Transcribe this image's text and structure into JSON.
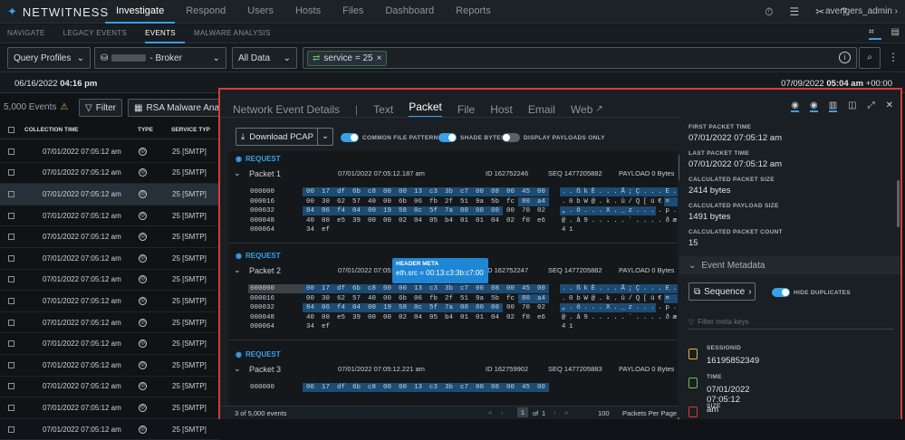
{
  "brand": {
    "name": "NETWITNESS"
  },
  "nav": {
    "items": [
      "Investigate",
      "Respond",
      "Users",
      "Hosts",
      "Files",
      "Dashboard",
      "Reports"
    ],
    "user": "avengers_admin"
  },
  "subnav": {
    "items": [
      "NAVIGATE",
      "LEGACY EVENTS",
      "EVENTS",
      "MALWARE ANALYSIS"
    ]
  },
  "query": {
    "profile": "Query Profiles",
    "service": "- Broker",
    "timerange": "All Data",
    "filter": "service = 25"
  },
  "time": {
    "start_date": "06/16/2022",
    "start_time": "04:16 pm",
    "end_date": "07/09/2022",
    "end_time": "05:04 am",
    "end_tz": "+00:00"
  },
  "events": {
    "count": "5,000 Events",
    "filter_label": "Filter",
    "profile": "RSA Malware Analysis",
    "columns": [
      "COLLECTION TIME",
      "TYPE",
      "SERVICE TYP"
    ],
    "rows": [
      {
        "time": "07/01/2022 07:05:12 am",
        "service": "25 [SMTP]"
      },
      {
        "time": "07/01/2022 07:05:12 am",
        "service": "25 [SMTP]"
      },
      {
        "time": "07/01/2022 07:05:12 am",
        "service": "25 [SMTP]"
      },
      {
        "time": "07/01/2022 07:05:12 am",
        "service": "25 [SMTP]"
      },
      {
        "time": "07/01/2022 07:05:12 am",
        "service": "25 [SMTP]"
      },
      {
        "time": "07/01/2022 07:05:12 am",
        "service": "25 [SMTP]"
      },
      {
        "time": "07/01/2022 07:05:12 am",
        "service": "25 [SMTP]"
      },
      {
        "time": "07/01/2022 07:05:12 am",
        "service": "25 [SMTP]"
      },
      {
        "time": "07/01/2022 07:05:12 am",
        "service": "25 [SMTP]"
      },
      {
        "time": "07/01/2022 07:05:12 am",
        "service": "25 [SMTP]"
      },
      {
        "time": "07/01/2022 07:05:12 am",
        "service": "25 [SMTP]"
      },
      {
        "time": "07/01/2022 07:05:12 am",
        "service": "25 [SMTP]"
      },
      {
        "time": "07/01/2022 07:05:12 am",
        "service": "25 [SMTP]"
      },
      {
        "time": "07/01/2022 07:05:12 am",
        "service": "25 [SMTP]"
      }
    ]
  },
  "panel": {
    "tabs": [
      "Network Event Details",
      "Text",
      "Packet",
      "File",
      "Host",
      "Email",
      "Web"
    ],
    "download": "Download PCAP",
    "opt1": "COMMON FILE PATTERNS",
    "opt2": "SHADE BYTES",
    "opt3": "DISPLAY PAYLOADS ONLY",
    "request": "REQUEST",
    "packets": [
      {
        "name": "Packet 1",
        "time": "07/01/2022 07:05:12.187 am",
        "id": "ID 162752246",
        "seq": "SEQ 1477205882",
        "payload": "PAYLOAD 0 Bytes"
      },
      {
        "name": "Packet 2",
        "time": "07/01/2022 07:05:12.2",
        "id": "ID 162752247",
        "seq": "SEQ 1477205882",
        "payload": "PAYLOAD 0 Bytes"
      },
      {
        "name": "Packet 3",
        "time": "07/01/2022 07:05:12.221 am",
        "id": "ID 162759902",
        "seq": "SEQ 1477205883",
        "payload": "PAYLOAD 0 Bytes"
      }
    ],
    "offsets": [
      "000000",
      "000016",
      "000032",
      "000048",
      "000064"
    ],
    "hex": [
      [
        "00",
        "17",
        "df",
        "6b",
        "c8",
        "00",
        "00",
        "13",
        "c3",
        "3b",
        "c7",
        "00",
        "08",
        "00",
        "45",
        "00"
      ],
      [
        "00",
        "30",
        "62",
        "57",
        "40",
        "00",
        "6b",
        "06",
        "fb",
        "2f",
        "51",
        "9a",
        "5b",
        "fc",
        "80",
        "a4"
      ],
      [
        "84",
        "06",
        "f4",
        "04",
        "00",
        "19",
        "58",
        "0c",
        "5f",
        "7a",
        "00",
        "00",
        "00",
        "00",
        "70",
        "02"
      ],
      [
        "40",
        "00",
        "e5",
        "39",
        "00",
        "00",
        "02",
        "04",
        "05",
        "b4",
        "01",
        "01",
        "04",
        "02",
        "f0",
        "e6"
      ],
      [
        "34",
        "ef"
      ]
    ],
    "ascii": [
      [
        ".",
        ".",
        "ß",
        "k",
        "È",
        ".",
        ".",
        ".",
        "Ã",
        ";",
        "Ç",
        ".",
        ".",
        ".",
        "E",
        "."
      ],
      [
        ".",
        "0",
        "b",
        "W",
        "@",
        ".",
        "k",
        ".",
        "û",
        "/",
        "Q",
        "[",
        "ü",
        "€",
        "¤",
        ""
      ],
      [
        "„",
        ".",
        "ô",
        ".",
        ".",
        ".",
        "X",
        ".",
        "_",
        "z",
        ".",
        ".",
        ".",
        ".",
        "p",
        "."
      ],
      [
        "@",
        ".",
        "å",
        "9",
        ".",
        ".",
        ".",
        ".",
        ".",
        "´",
        ".",
        ".",
        ".",
        ".",
        "ð",
        "æ"
      ],
      [
        "4",
        "ï"
      ]
    ],
    "tooltip": {
      "title": "HEADER META",
      "text": "eth.src = 00:13:c3:3b:c7:00"
    },
    "meta": [
      {
        "label": "FIRST PACKET TIME",
        "value": "07/01/2022 07:05:12 am"
      },
      {
        "label": "LAST PACKET TIME",
        "value": "07/01/2022 07:05:12 am"
      },
      {
        "label": "CALCULATED PACKET SIZE",
        "value": "2414 bytes"
      },
      {
        "label": "CALCULATED PAYLOAD SIZE",
        "value": "1491 bytes"
      },
      {
        "label": "CALCULATED PACKET COUNT",
        "value": "15"
      }
    ],
    "event_metadata": "Event Metadata",
    "sequence": "Sequence",
    "hide_dup": "HIDE DUPLICATES",
    "filter_ph": "Filter meta keys",
    "fields": [
      {
        "label": "SESSIONID",
        "value": "16195852349"
      },
      {
        "label": "TIME",
        "value": "07/01/2022 07:05:12 am"
      },
      {
        "label": "SIZE",
        "value": ""
      }
    ]
  },
  "footer": {
    "count": "3 of 5,000 events",
    "page": "1",
    "of": "of",
    "total": "1",
    "per_page": "100",
    "per_page_label": "Packets Per Page"
  }
}
